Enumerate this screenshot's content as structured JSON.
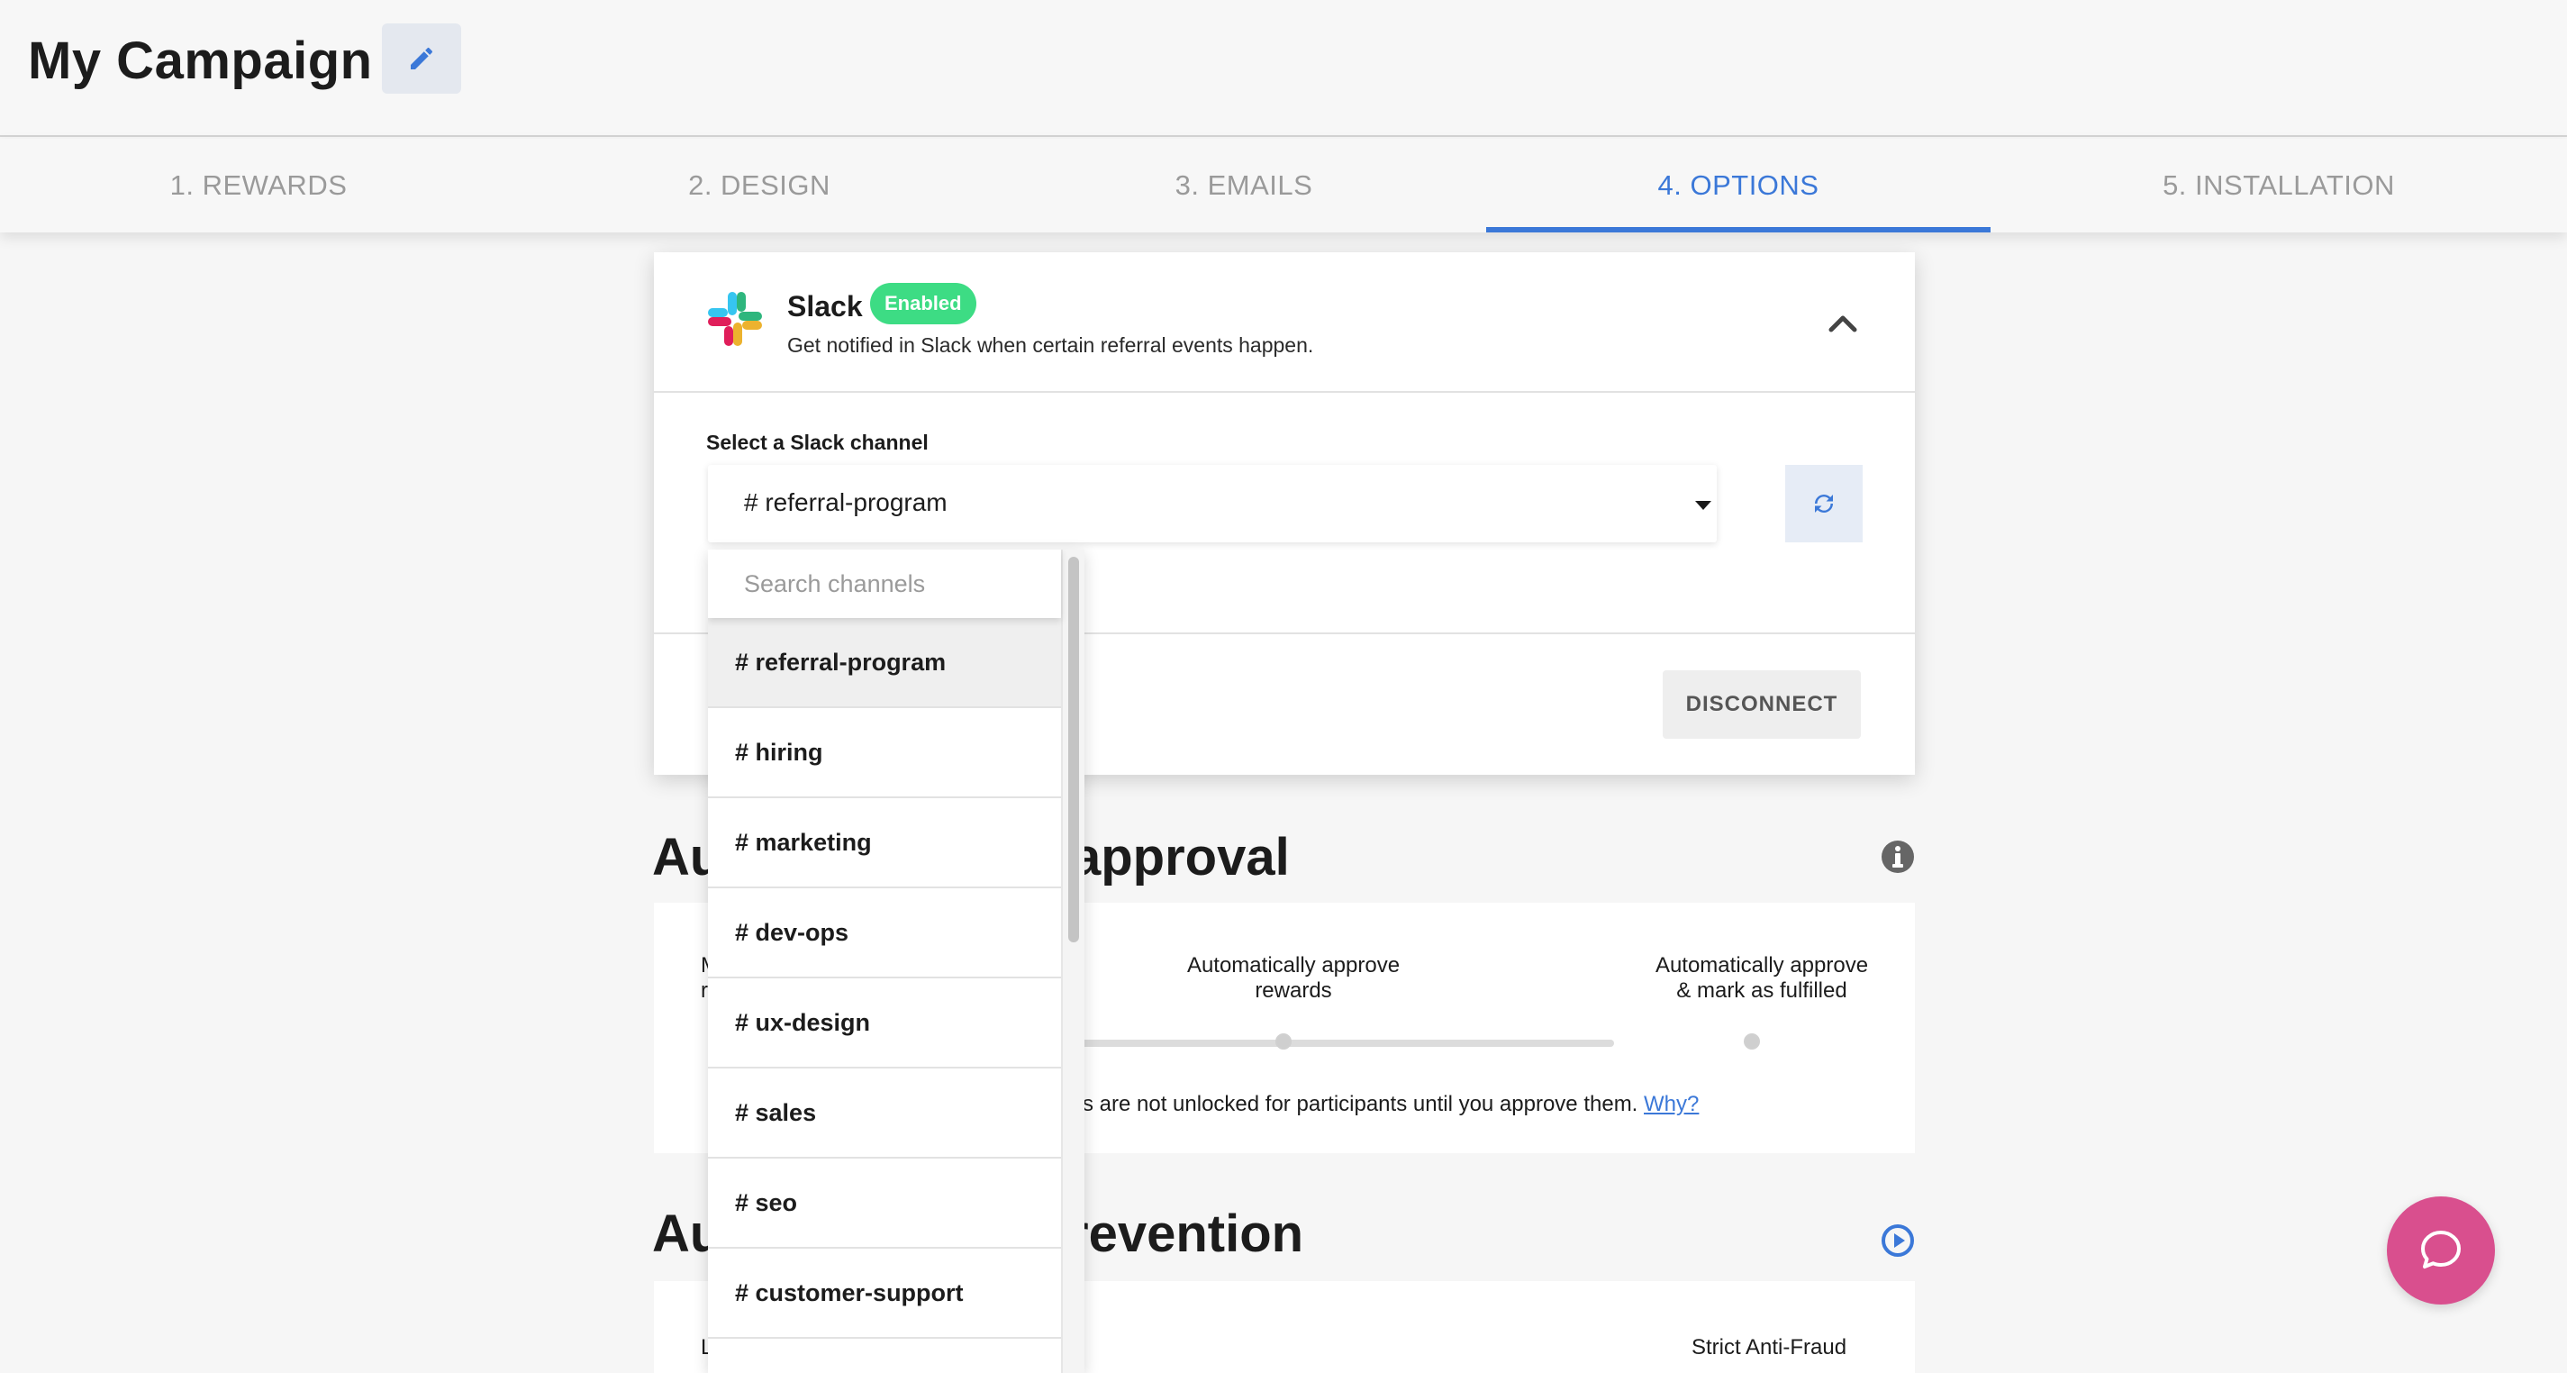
{
  "header": {
    "title": "My Campaign",
    "edit_icon": "pencil-icon"
  },
  "tabs": [
    {
      "label": "1. REWARDS",
      "active": false
    },
    {
      "label": "2. DESIGN",
      "active": false
    },
    {
      "label": "3. EMAILS",
      "active": false
    },
    {
      "label": "4. OPTIONS",
      "active": true
    },
    {
      "label": "5. INSTALLATION",
      "active": false
    }
  ],
  "slack": {
    "name": "Slack",
    "badge": "Enabled",
    "description": "Get notified in Slack when certain referral events happen.",
    "channel_label": "Select a Slack channel",
    "selected_channel": "# referral-program",
    "disconnect_label": "DISCONNECT",
    "search_placeholder": "Search channels",
    "channels": [
      "# referral-program",
      "# hiring",
      "# marketing",
      "# dev-ops",
      "# ux-design",
      "# sales",
      "# seo",
      "# customer-support"
    ]
  },
  "approval": {
    "title_left": "Au",
    "title_right": "approval",
    "option_left_fragment_1": "M",
    "option_left_fragment_2": "r",
    "option_middle": "Automatically approve rewards",
    "option_right_line1": "Automatically approve",
    "option_right_line2": "& mark as fulfilled",
    "note_fragment": "s are not unlocked for participants until you approve them.",
    "note_fragment_prefix": "'",
    "why_link": "Why?"
  },
  "fraud": {
    "title_left": "Au",
    "title_right": "revention",
    "left_label_fragment": "L",
    "right_label": "Strict Anti-Fraud"
  },
  "colors": {
    "accent": "#3b78d8",
    "enabled_badge": "#3ddc84",
    "chat": "#d94f8e"
  }
}
